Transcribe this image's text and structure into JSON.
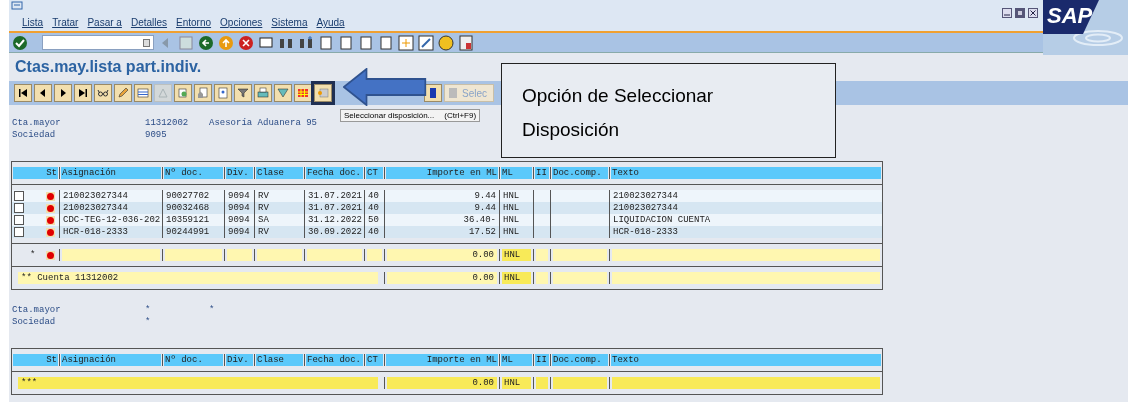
{
  "menu": [
    {
      "label": "Lista"
    },
    {
      "label": "Tratar"
    },
    {
      "label": "Pasar a"
    },
    {
      "label": "Detalles"
    },
    {
      "label": "Entorno"
    },
    {
      "label": "Opciones"
    },
    {
      "label": "Sistema"
    },
    {
      "label": "Ayuda"
    }
  ],
  "logo": "SAP",
  "title": "Ctas.may.lista part.indiv.",
  "app_toolbar": {
    "button_label": "Selec"
  },
  "tooltip": {
    "text": "Seleccionar disposición...",
    "shortcut": "(Ctrl+F9)"
  },
  "callout": {
    "lines": [
      "Opción de Seleccionar",
      "Disposición"
    ]
  },
  "sections": [
    {
      "header": [
        {
          "label": "Cta.mayor",
          "value": "11312002",
          "extra": "Asesoría Aduanera 95"
        },
        {
          "label": "Sociedad",
          "value": "9095"
        }
      ],
      "columns": [
        "St",
        "Asignación",
        "Nº doc.",
        "Div.",
        "Clase",
        "Fecha doc.",
        "CT",
        "Importe en ML",
        "ML",
        "II",
        "Doc.comp.",
        "Texto"
      ],
      "rows": [
        {
          "kind": "item",
          "checked": false,
          "color": "#e00000",
          "cells": [
            "210023027344",
            "90027702",
            "9094",
            "RV",
            "31.07.2021",
            "40",
            "9.44",
            "HNL",
            "",
            "",
            "210023027344"
          ]
        },
        {
          "kind": "item",
          "checked": false,
          "color": "#e00000",
          "cells": [
            "210023027344",
            "90032468",
            "9094",
            "RV",
            "31.07.2021",
            "40",
            "9.44",
            "HNL",
            "",
            "",
            "210023027344"
          ]
        },
        {
          "kind": "item",
          "checked": false,
          "color": "#e00000",
          "cells": [
            "CDC-TEG-12-036-202",
            "10359121",
            "9094",
            "SA",
            "31.12.2022",
            "50",
            "36.40-",
            "HNL",
            "",
            "",
            "LIQUIDACION CUENTA"
          ]
        },
        {
          "kind": "item",
          "checked": false,
          "color": "#e00000",
          "cells": [
            "HCR-018-2333",
            "90244991",
            "9094",
            "RV",
            "30.09.2022",
            "40",
            "17.52",
            "HNL",
            "",
            "",
            "HCR-018-2333"
          ]
        },
        {
          "kind": "subtotal",
          "marker": "*",
          "color": "#e00000",
          "amount": "0.00",
          "currency": "HNL"
        },
        {
          "kind": "total",
          "label": "** Cuenta 11312002",
          "amount": "0.00",
          "currency": "HNL"
        }
      ]
    },
    {
      "header": [
        {
          "label": "Cta.mayor",
          "value": "*",
          "extra": "*"
        },
        {
          "label": "Sociedad",
          "value": "*"
        }
      ],
      "columns": [
        "St",
        "Asignación",
        "Nº doc.",
        "Div.",
        "Clase",
        "Fecha doc.",
        "CT",
        "Importe en ML",
        "ML",
        "II",
        "Doc.comp.",
        "Texto"
      ],
      "rows": [
        {
          "kind": "total",
          "label": "***",
          "amount": "0.00",
          "currency": "HNL"
        }
      ]
    }
  ]
}
